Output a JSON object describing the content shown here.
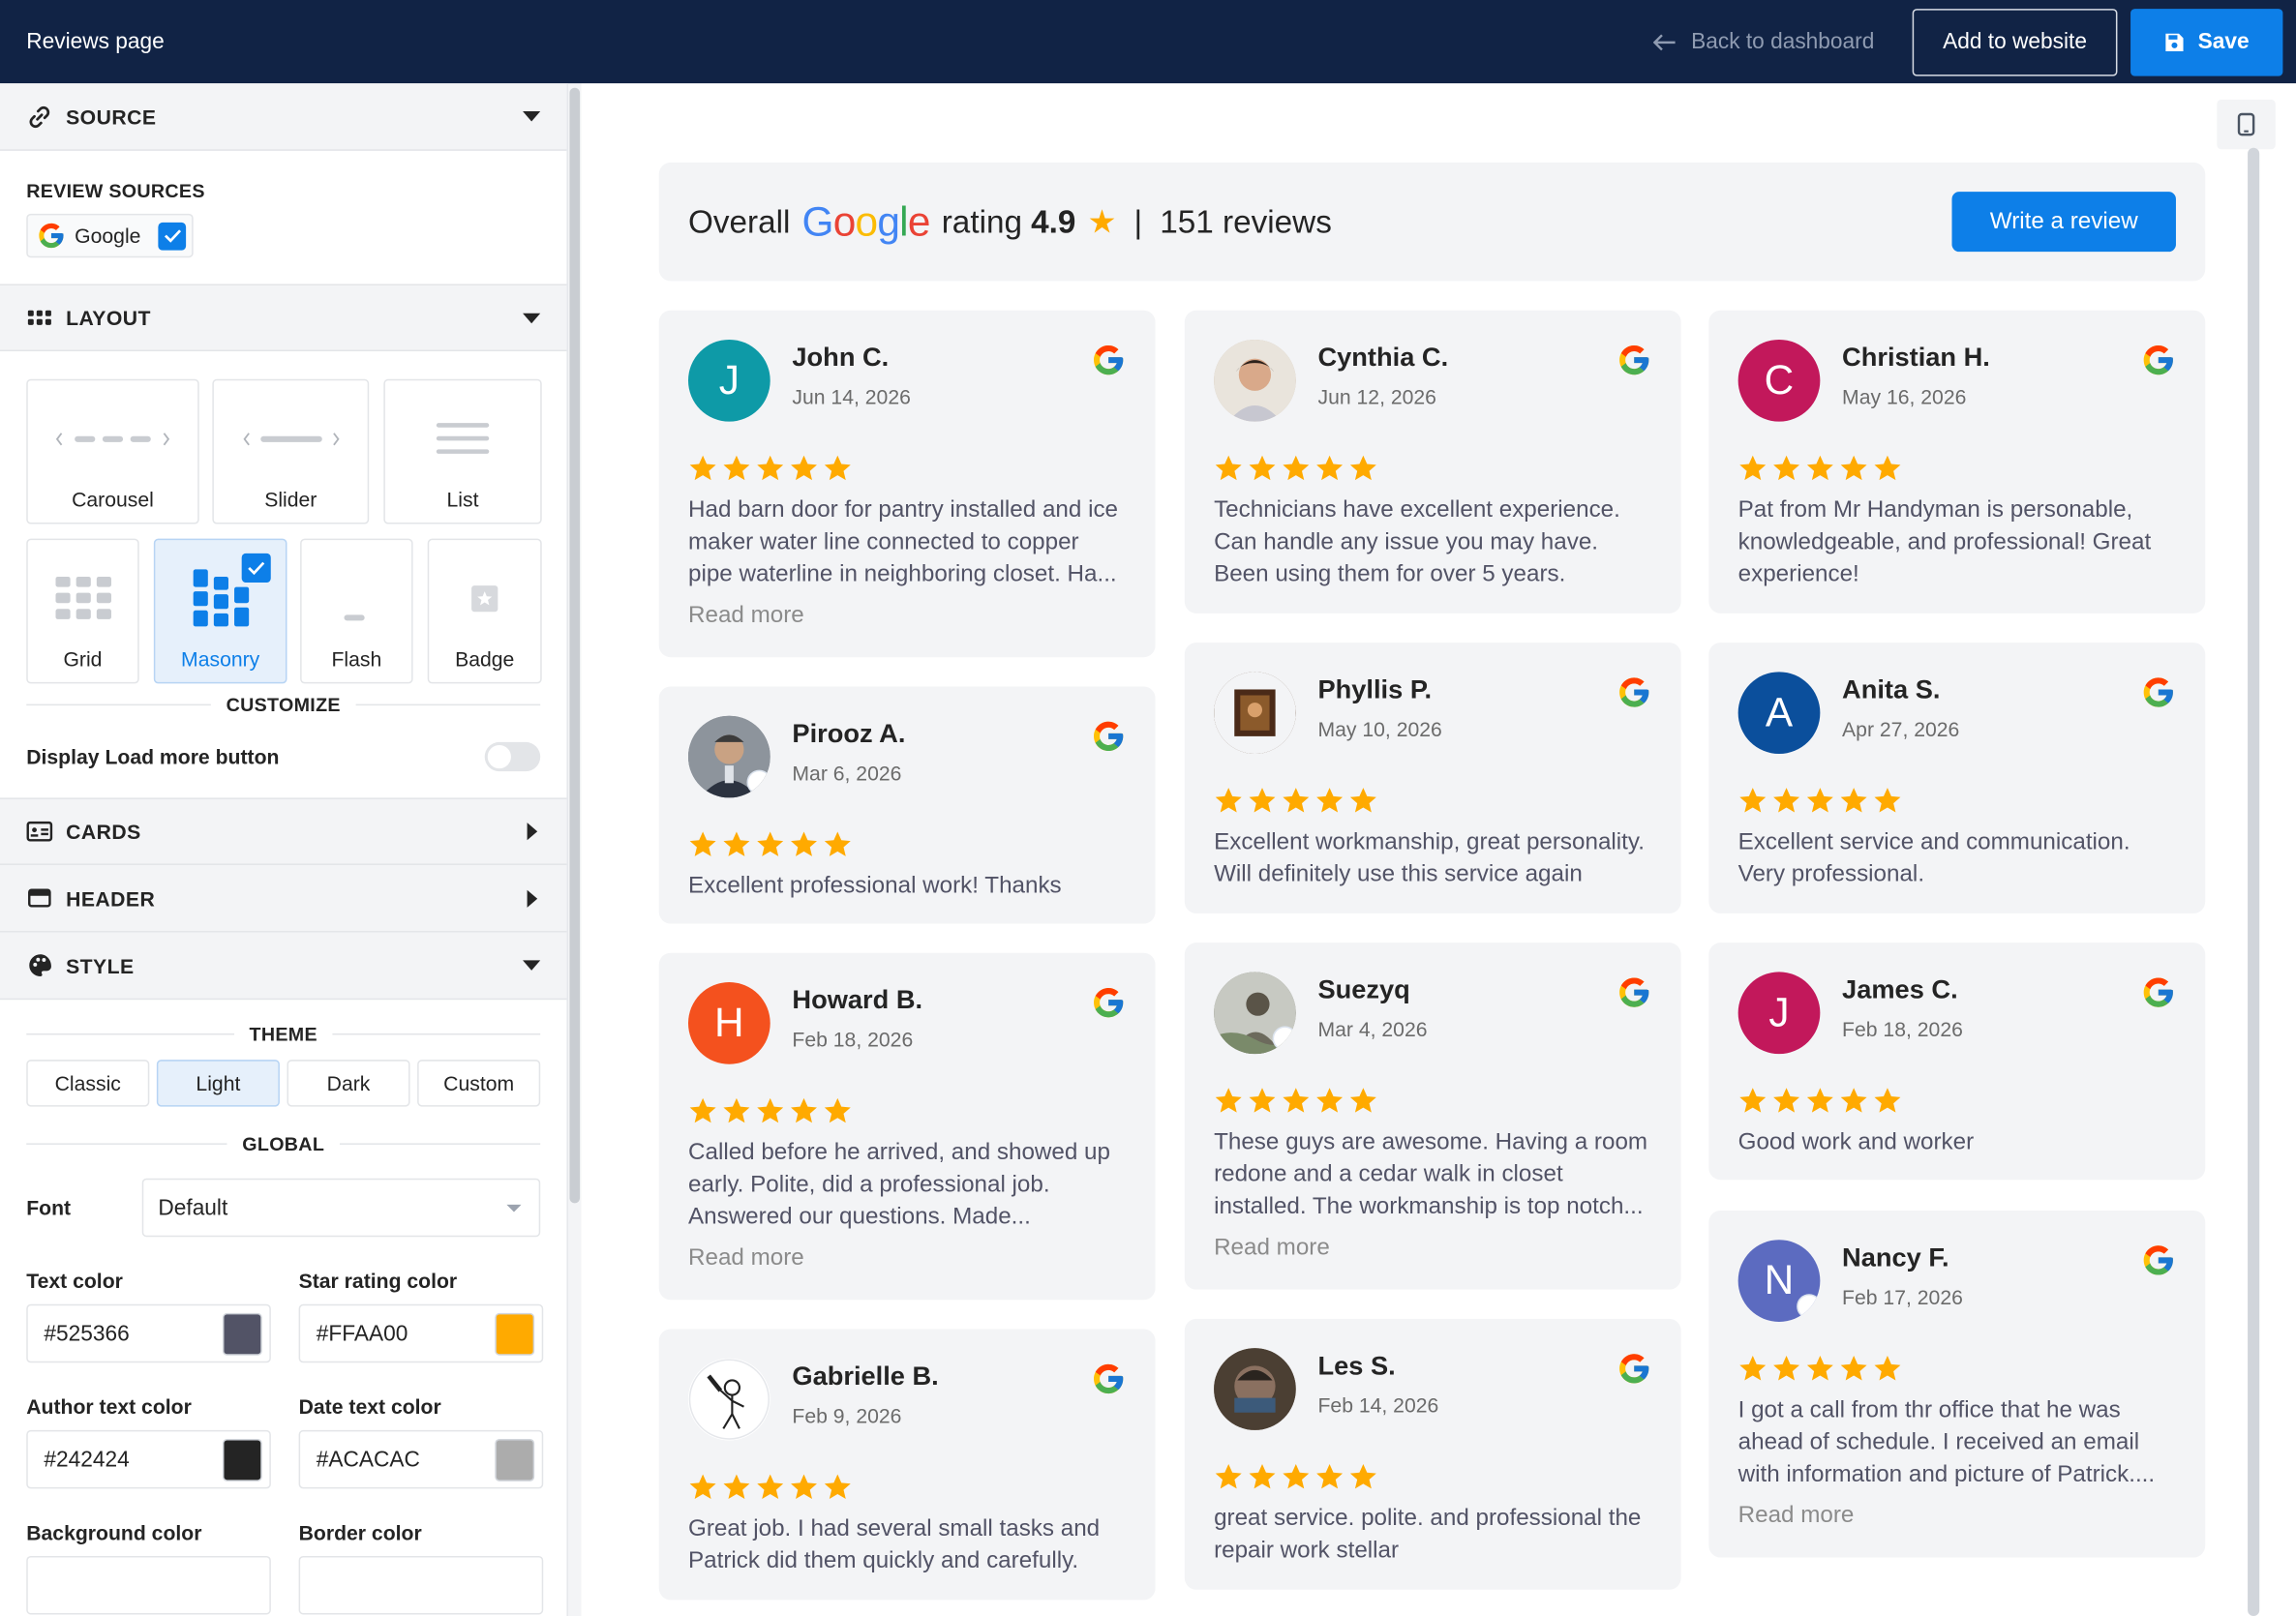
{
  "topbar": {
    "title": "Reviews page",
    "back_label": "Back to dashboard",
    "add_label": "Add to website",
    "save_label": "Save"
  },
  "sidebar": {
    "source": {
      "title": "SOURCE",
      "review_sources_label": "REVIEW SOURCES",
      "google_label": "Google",
      "google_checked": true
    },
    "layout": {
      "title": "LAYOUT",
      "options": [
        "Carousel",
        "Slider",
        "List",
        "Grid",
        "Masonry",
        "Flash",
        "Badge"
      ],
      "selected": "Masonry"
    },
    "customize": {
      "title": "CUSTOMIZE",
      "load_more_label": "Display Load more button",
      "load_more_on": false
    },
    "cards": {
      "title": "CARDS"
    },
    "header": {
      "title": "HEADER"
    },
    "style": {
      "title": "STYLE",
      "theme_label": "THEME",
      "themes": [
        "Classic",
        "Light",
        "Dark",
        "Custom"
      ],
      "theme_selected": "Light",
      "global_label": "GLOBAL",
      "font_label": "Font",
      "font_value": "Default",
      "colors": [
        {
          "label": "Text color",
          "value": "#525366"
        },
        {
          "label": "Star rating color",
          "value": "#FFAA00"
        },
        {
          "label": "Author text color",
          "value": "#242424"
        },
        {
          "label": "Date text color",
          "value": "#ACACAC"
        },
        {
          "label": "Background color",
          "value": ""
        },
        {
          "label": "Border color",
          "value": ""
        }
      ]
    }
  },
  "summary": {
    "overall": "Overall",
    "google_word": "Google",
    "rating_word": "rating",
    "rating": "4.9",
    "separator": "|",
    "reviews": "151 reviews",
    "write_review": "Write a review"
  },
  "accent_color": "#0d7fe8",
  "star_color": "#FFAA00",
  "reviews": [
    {
      "name": "John C.",
      "date": "Jun 14, 2026",
      "initial": "J",
      "avatar_color": "#0e9aa7",
      "photo": false,
      "stars": 5,
      "text": "Had barn door for pantry installed and ice maker water line connected to copper pipe waterline in neighboring closet. Ha...",
      "read_more": "Read more"
    },
    {
      "name": "Cynthia C.",
      "date": "Jun 12, 2026",
      "initial": "",
      "avatar_color": "#c9b9a6",
      "photo": true,
      "stars": 5,
      "text": "Technicians have excellent experience. Can handle any issue you may have. Been using them for over 5 years.",
      "read_more": ""
    },
    {
      "name": "Christian H.",
      "date": "May 16, 2026",
      "initial": "C",
      "avatar_color": "#c2185b",
      "photo": false,
      "stars": 5,
      "text": "Pat from Mr Handyman is personable, knowledgeable, and professional! Great experience!",
      "read_more": ""
    },
    {
      "name": "Pirooz A.",
      "date": "Mar 6, 2026",
      "initial": "",
      "avatar_color": "#6d7480",
      "photo": true,
      "stars": 5,
      "text": "Excellent professional work! Thanks",
      "read_more": ""
    },
    {
      "name": "Phyllis P.",
      "date": "May 10, 2026",
      "initial": "",
      "avatar_color": "#5a3a24",
      "photo": true,
      "stars": 5,
      "text": "Excellent workmanship, great personality. Will definitely use this service again",
      "read_more": ""
    },
    {
      "name": "Anita S.",
      "date": "Apr 27, 2026",
      "initial": "A",
      "avatar_color": "#0b4f9c",
      "photo": false,
      "stars": 5,
      "text": "Excellent service and communication. Very professional.",
      "read_more": ""
    },
    {
      "name": "Howard B.",
      "date": "Feb 18, 2026",
      "initial": "H",
      "avatar_color": "#f4511e",
      "photo": false,
      "stars": 5,
      "text": "Called before he arrived, and showed up early. Polite, did a professional job. Answered our questions. Made...",
      "read_more": "Read more"
    },
    {
      "name": "Suezyq",
      "date": "Mar 4, 2026",
      "initial": "",
      "avatar_color": "#7b7c6e",
      "photo": true,
      "stars": 5,
      "text": "These guys are awesome. Having a room redone and a cedar walk in closet installed. The workmanship is top notch...",
      "read_more": "Read more"
    },
    {
      "name": "James C.",
      "date": "Feb 18, 2026",
      "initial": "J",
      "avatar_color": "#c2185b",
      "photo": false,
      "stars": 5,
      "text": "Good work and worker",
      "read_more": ""
    },
    {
      "name": "Nancy F.",
      "date": "Feb 17, 2026",
      "initial": "N",
      "avatar_color": "#5c6bc0",
      "photo": false,
      "stars": 5,
      "text": "I got a call from thr office that he was ahead of schedule. I received an email with information and picture of Patrick....",
      "read_more": "Read more"
    },
    {
      "name": "Gabrielle B.",
      "date": "Feb 9, 2026",
      "initial": "",
      "avatar_color": "#ffffff",
      "photo": true,
      "stars": 5,
      "text": "Great job. I had several small tasks and Patrick did them quickly and carefully.",
      "read_more": ""
    },
    {
      "name": "Les S.",
      "date": "Feb 14, 2026",
      "initial": "",
      "avatar_color": "#5d4a3a",
      "photo": true,
      "stars": 5,
      "text": "great service. polite. and professional the repair work stellar",
      "read_more": ""
    }
  ]
}
